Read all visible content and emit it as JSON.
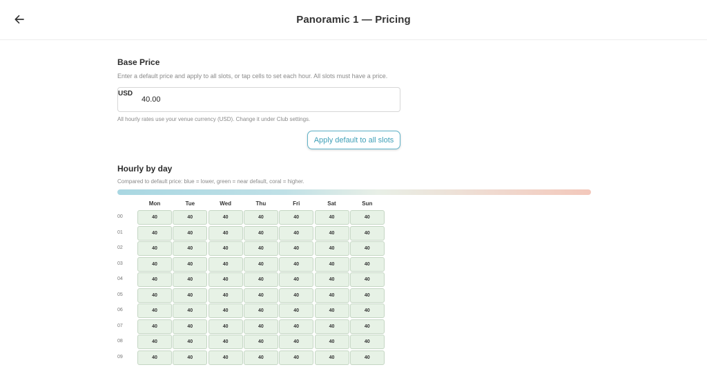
{
  "header": {
    "title": "Panoramic 1 — Pricing",
    "back_icon": "arrow-left-icon"
  },
  "base_price": {
    "title": "Base Price",
    "description": "Enter a default price and apply to all slots, or tap cells to set each hour. All slots must have a price.",
    "currency": "USD",
    "value": "40.00",
    "note": "All hourly rates use your venue currency (USD). Change it under Club settings.",
    "apply_button": "Apply default to all slots"
  },
  "hourly": {
    "title": "Hourly by day",
    "legend_text": "Compared to default price: blue = lower, green = near default, coral = higher.",
    "colors": {
      "lower": "#a9d7e2",
      "near": "#e7f2e6",
      "higher": "#f3c8bb"
    },
    "days": [
      "Mon",
      "Tue",
      "Wed",
      "Thu",
      "Fri",
      "Sat",
      "Sun"
    ],
    "rows": [
      {
        "hour": "00",
        "prices": [
          "40",
          "40",
          "40",
          "40",
          "40",
          "40",
          "40"
        ]
      },
      {
        "hour": "01",
        "prices": [
          "40",
          "40",
          "40",
          "40",
          "40",
          "40",
          "40"
        ]
      },
      {
        "hour": "02",
        "prices": [
          "40",
          "40",
          "40",
          "40",
          "40",
          "40",
          "40"
        ]
      },
      {
        "hour": "03",
        "prices": [
          "40",
          "40",
          "40",
          "40",
          "40",
          "40",
          "40"
        ]
      },
      {
        "hour": "04",
        "prices": [
          "40",
          "40",
          "40",
          "40",
          "40",
          "40",
          "40"
        ]
      },
      {
        "hour": "05",
        "prices": [
          "40",
          "40",
          "40",
          "40",
          "40",
          "40",
          "40"
        ]
      },
      {
        "hour": "06",
        "prices": [
          "40",
          "40",
          "40",
          "40",
          "40",
          "40",
          "40"
        ]
      },
      {
        "hour": "07",
        "prices": [
          "40",
          "40",
          "40",
          "40",
          "40",
          "40",
          "40"
        ]
      },
      {
        "hour": "08",
        "prices": [
          "40",
          "40",
          "40",
          "40",
          "40",
          "40",
          "40"
        ]
      },
      {
        "hour": "09",
        "prices": [
          "40",
          "40",
          "40",
          "40",
          "40",
          "40",
          "40"
        ]
      }
    ]
  }
}
